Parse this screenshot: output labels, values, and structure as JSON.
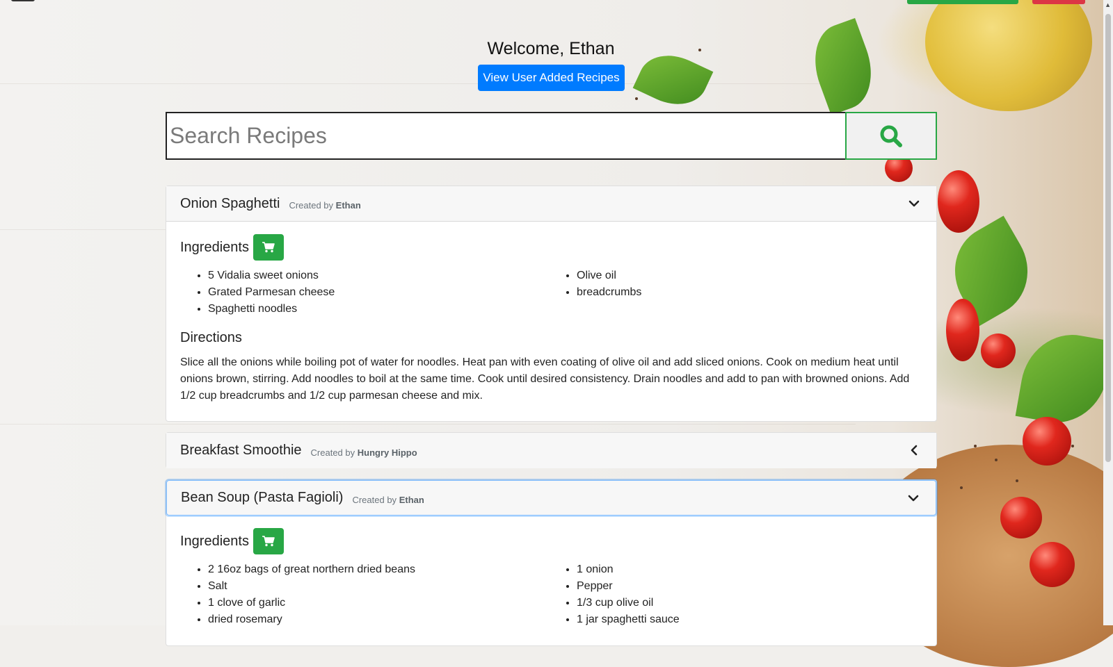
{
  "welcome": "Welcome, Ethan",
  "view_button": "View User Added Recipes",
  "search": {
    "placeholder": "Search Recipes"
  },
  "labels": {
    "ingredients": "Ingredients",
    "directions": "Directions",
    "created_by": "Created by"
  },
  "recipes": [
    {
      "title": "Onion Spaghetti",
      "author": "Ethan",
      "ingredients_left": [
        "5 Vidalia sweet onions",
        "Grated Parmesan cheese",
        "Spaghetti noodles"
      ],
      "ingredients_right": [
        "Olive oil",
        "breadcrumbs"
      ],
      "directions": "Slice all the onions while boiling pot of water for noodles. Heat pan with even coating of olive oil and add sliced onions. Cook on medium heat until onions brown, stirring. Add noodles to boil at the same time. Cook until desired consistency. Drain noodles and add to pan with browned onions. Add 1/2 cup breadcrumbs and 1/2 cup parmesan cheese and mix."
    },
    {
      "title": "Breakfast Smoothie",
      "author": "Hungry Hippo"
    },
    {
      "title": "Bean Soup (Pasta Fagioli)",
      "author": "Ethan",
      "ingredients_left": [
        "2 16oz bags of great northern dried beans",
        "Salt",
        "1 clove of garlic",
        "dried rosemary"
      ],
      "ingredients_right": [
        "1 onion",
        "Pepper",
        "1/3 cup olive oil",
        "1 jar spaghetti sauce"
      ]
    }
  ],
  "colors": {
    "primary": "#007bff",
    "success": "#28a745",
    "danger": "#dc3545"
  },
  "icons": {
    "search": "search-icon",
    "cart": "cart-icon",
    "chevron_down": "chevron-down-icon",
    "chevron_left": "chevron-left-icon"
  }
}
